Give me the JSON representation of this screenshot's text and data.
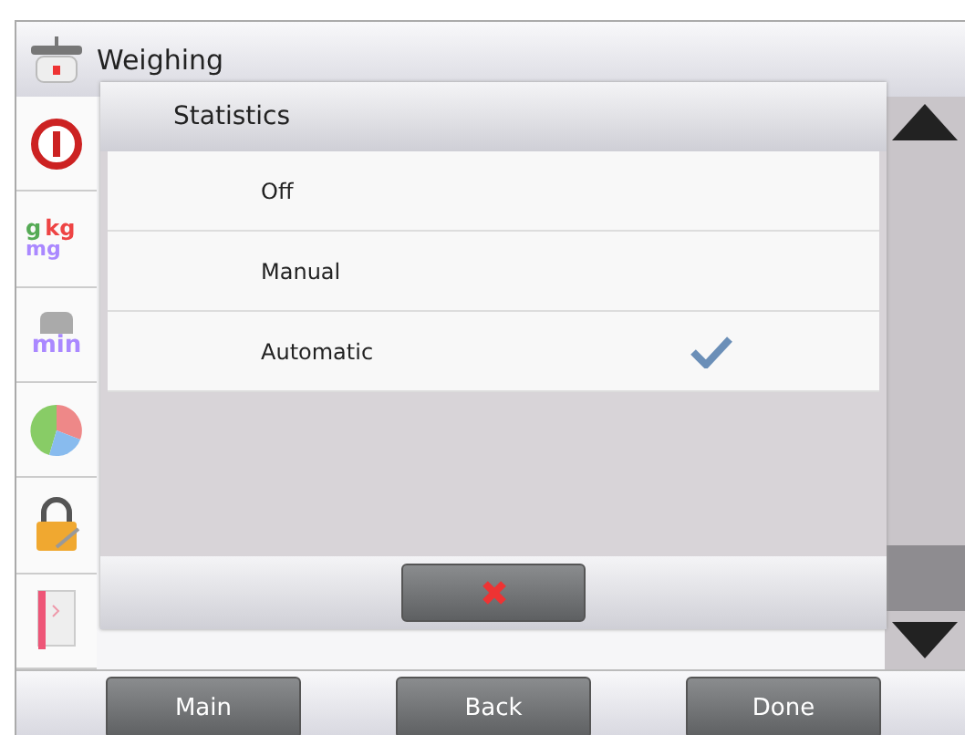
{
  "header": {
    "title": "Weighing"
  },
  "sidebar": {
    "items": [
      {
        "kind": "info"
      },
      {
        "kind": "units",
        "labels": [
          "g",
          "kg",
          "mg"
        ]
      },
      {
        "kind": "minweight",
        "labels": [
          "min"
        ]
      },
      {
        "kind": "pie"
      },
      {
        "kind": "lock"
      },
      {
        "kind": "book"
      }
    ]
  },
  "dialog": {
    "title": "Statistics",
    "options": [
      {
        "label": "Off",
        "selected": false
      },
      {
        "label": "Manual",
        "selected": false
      },
      {
        "label": "Automatic",
        "selected": true
      }
    ]
  },
  "footer": {
    "buttons": [
      "Main",
      "Back",
      "Done"
    ]
  }
}
